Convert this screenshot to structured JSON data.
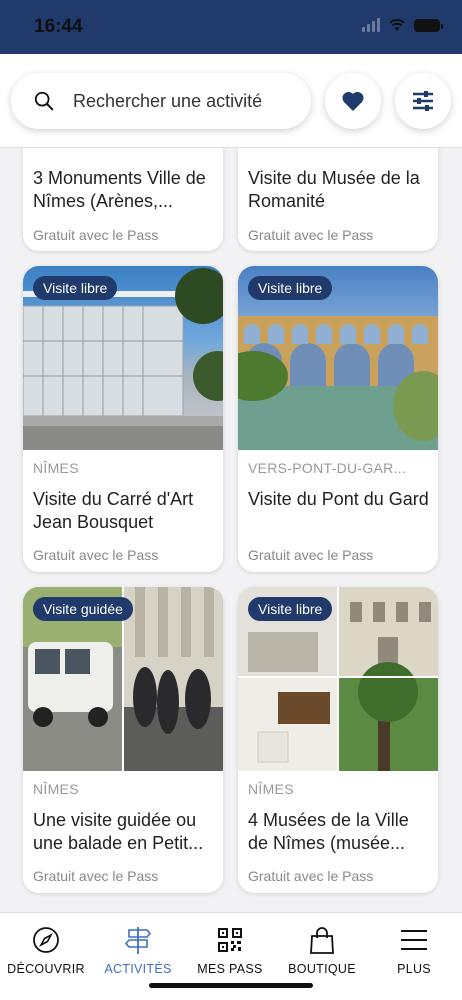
{
  "status_bar": {
    "time": "16:44"
  },
  "search": {
    "placeholder": "Rechercher une activité"
  },
  "colors": {
    "primary": "#1f3a6b",
    "accent": "#3d6fc2",
    "card_bg": "#ffffff"
  },
  "cards": [
    {
      "location": "",
      "title": "3 Monuments Ville de Nîmes (Arènes,...",
      "price": "Gratuit avec le Pass",
      "badge": ""
    },
    {
      "location": "",
      "title": "Visite du Musée de la Romanité",
      "price": "Gratuit avec le Pass",
      "badge": ""
    },
    {
      "location": "NÎMES",
      "title": "Visite du Carré d'Art Jean Bousquet",
      "price": "Gratuit avec le Pass",
      "badge": "Visite libre"
    },
    {
      "location": "VERS-PONT-DU-GAR...",
      "title": "Visite du Pont du Gard",
      "price": "Gratuit avec le Pass",
      "badge": "Visite libre"
    },
    {
      "location": "NÎMES",
      "title": "Une visite guidée ou une balade en Petit...",
      "price": "Gratuit avec le Pass",
      "badge": "Visite guidée"
    },
    {
      "location": "NÎMES",
      "title": "4 Musées de la Ville de Nîmes (musée...",
      "price": "Gratuit avec le Pass",
      "badge": "Visite libre"
    }
  ],
  "nav": {
    "items": [
      {
        "label": "DÉCOUVRIR",
        "icon": "compass-icon"
      },
      {
        "label": "ACTIVITÉS",
        "icon": "signpost-icon",
        "active": true
      },
      {
        "label": "MES PASS",
        "icon": "qr-code-icon"
      },
      {
        "label": "BOUTIQUE",
        "icon": "shopping-bag-icon"
      },
      {
        "label": "PLUS",
        "icon": "menu-icon"
      }
    ]
  }
}
